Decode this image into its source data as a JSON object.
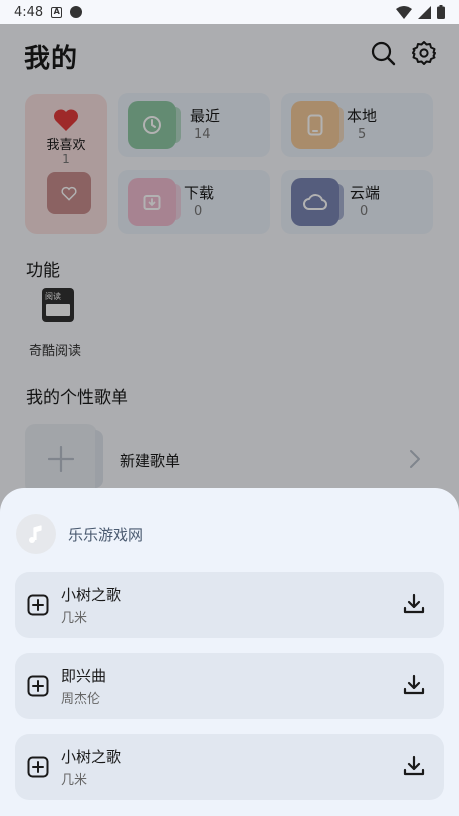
{
  "status_bar": {
    "time": "4:48"
  },
  "header": {
    "title": "我的"
  },
  "cards": {
    "favorites": {
      "label": "我喜欢",
      "count": "1"
    },
    "recent": {
      "label": "最近",
      "count": "14"
    },
    "local": {
      "label": "本地",
      "count": "5"
    },
    "downloads": {
      "label": "下载",
      "count": "0"
    },
    "cloud": {
      "label": "云端",
      "count": "0"
    }
  },
  "functions": {
    "title": "功能",
    "items": [
      {
        "label": "奇酷阅读",
        "icon_text": "阅读"
      }
    ]
  },
  "playlists": {
    "title": "我的个性歌单",
    "new_label": "新建歌单"
  },
  "sheet": {
    "source": "乐乐游戏网",
    "songs": [
      {
        "title": "小树之歌",
        "artist": "几米"
      },
      {
        "title": "即兴曲",
        "artist": "周杰伦"
      },
      {
        "title": "小树之歌",
        "artist": "几米"
      }
    ]
  },
  "colors": {
    "recent_thumb": "#8fc8a4",
    "local_thumb": "#f2c99a",
    "download_thumb": "#f0bcd0",
    "cloud_thumb": "#7a86b4",
    "favorite_heart": "#e23b3b"
  }
}
